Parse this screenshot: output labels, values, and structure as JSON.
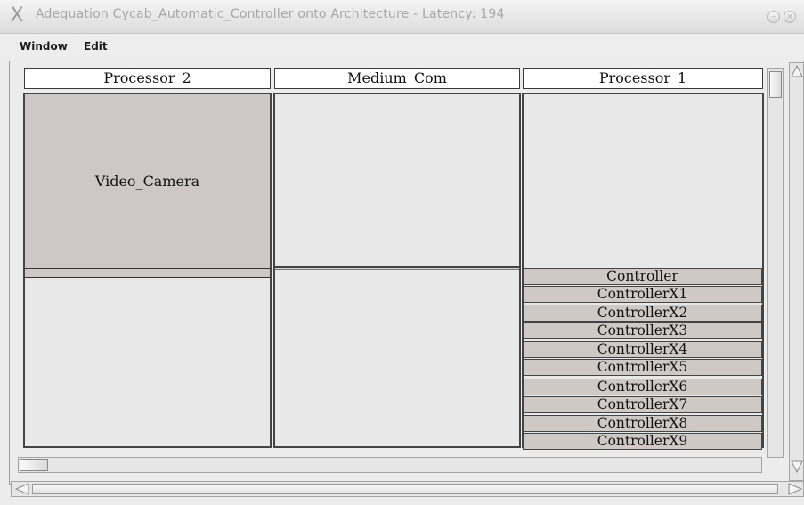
{
  "window": {
    "title": "Adequation Cycab_Automatic_Controller onto Architecture - Latency: 194",
    "close_glyph": "X",
    "minimize_glyph": "–",
    "close_circle_glyph": "×"
  },
  "menu": {
    "items": [
      "Window",
      "Edit"
    ]
  },
  "columns": [
    {
      "header": "Processor_2",
      "operation": "Video_Camera"
    },
    {
      "header": "Medium_Com"
    },
    {
      "header": "Processor_1",
      "operations": [
        "Controller",
        "ControllerX1",
        "ControllerX2",
        "ControllerX3",
        "ControllerX4",
        "ControllerX5",
        "ControllerX6",
        "ControllerX7",
        "ControllerX8",
        "ControllerX9"
      ]
    }
  ],
  "colors": {
    "operation_fill": "#cdc8c5",
    "background": "#e8e8e8",
    "border": "#444444"
  },
  "icons": {
    "scroll_up": "triangle-up-icon",
    "scroll_left": "triangle-left-icon",
    "scroll_right": "triangle-right-icon",
    "scroll_down": "triangle-down-icon"
  }
}
